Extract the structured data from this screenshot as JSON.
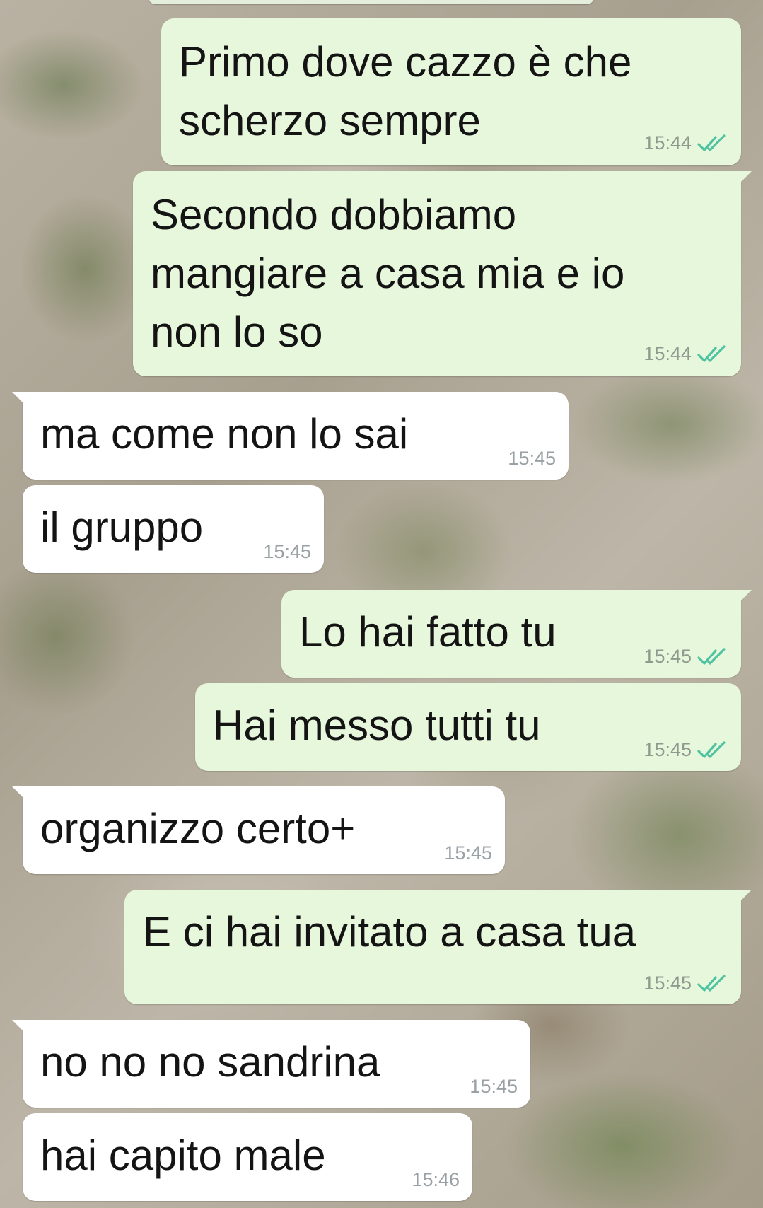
{
  "chat": {
    "tick_color": "#4fc3a1",
    "messages": [
      {
        "direction": "out",
        "text": "Primo dove cazzo è che\nscherzo sempre",
        "time": "15:44",
        "status_icon": "double-check-icon"
      },
      {
        "direction": "out",
        "text": "Secondo dobbiamo\nmangiare a casa mia e io\nnon lo so",
        "time": "15:44",
        "status_icon": "double-check-icon"
      },
      {
        "direction": "in",
        "text": "ma come non lo sai",
        "time": "15:45"
      },
      {
        "direction": "in",
        "text": "il gruppo",
        "time": "15:45"
      },
      {
        "direction": "out",
        "text": "Lo hai fatto tu",
        "time": "15:45",
        "status_icon": "double-check-icon"
      },
      {
        "direction": "out",
        "text": "Hai messo tutti tu",
        "time": "15:45",
        "status_icon": "double-check-icon"
      },
      {
        "direction": "in",
        "text": "organizzo certo+",
        "time": "15:45"
      },
      {
        "direction": "out",
        "text": "E ci hai invitato a casa tua",
        "time": "15:45",
        "status_icon": "double-check-icon"
      },
      {
        "direction": "in",
        "text": "no no no sandrina",
        "time": "15:45"
      },
      {
        "direction": "in",
        "text": "hai capito male",
        "time": "15:46"
      }
    ]
  }
}
